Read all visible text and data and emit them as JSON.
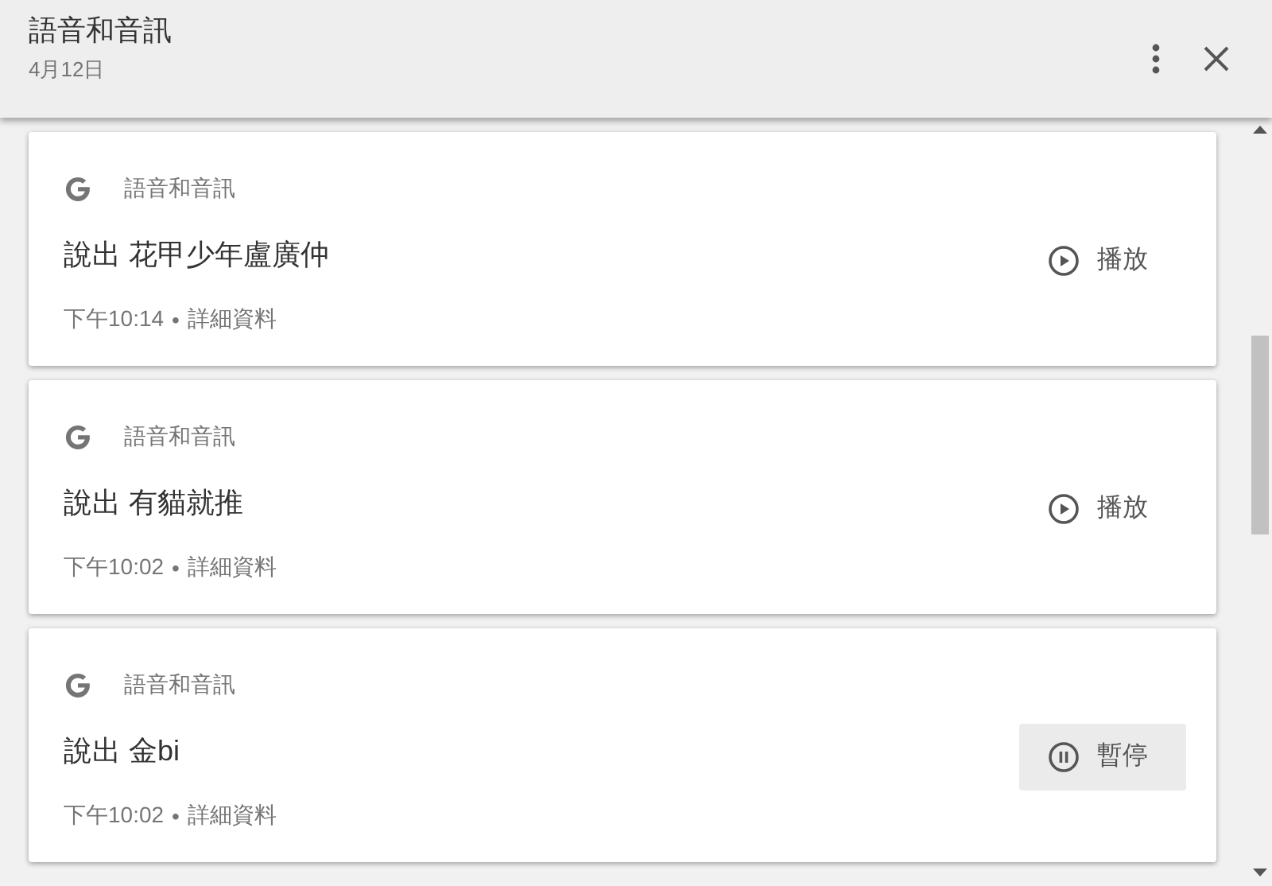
{
  "header": {
    "title": "語音和音訊",
    "subtitle": "4月12日"
  },
  "cards": [
    {
      "app": "語音和音訊",
      "title": "說出 花甲少年盧廣仲",
      "time": "下午10:14",
      "separator": "•",
      "details": "詳細資料",
      "button": {
        "kind": "play",
        "label": "播放"
      }
    },
    {
      "app": "語音和音訊",
      "title": "說出 有貓就推",
      "time": "下午10:02",
      "separator": "•",
      "details": "詳細資料",
      "button": {
        "kind": "play",
        "label": "播放"
      }
    },
    {
      "app": "語音和音訊",
      "title": "說出 金bi",
      "time": "下午10:02",
      "separator": "•",
      "details": "詳細資料",
      "button": {
        "kind": "pause",
        "label": "暫停"
      }
    }
  ]
}
